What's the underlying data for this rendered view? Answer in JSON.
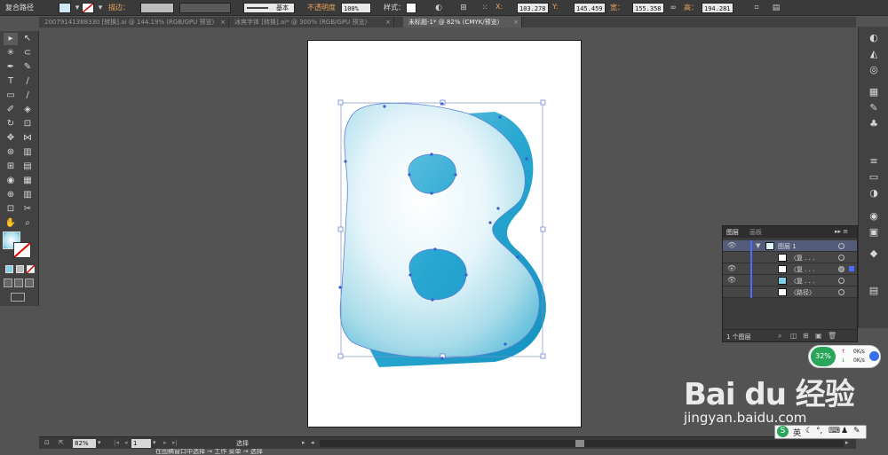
{
  "control_bar": {
    "object_type": "复合路径",
    "stroke_label": "描边：",
    "stroke_style": "基本",
    "opacity_label": "不透明度",
    "opacity_value": "100%",
    "style_label": "样式：",
    "x_label": "X:",
    "x_value": "103.278",
    "y_label": "Y:",
    "y_value": "145.459",
    "w_label": "宽：",
    "w_value": "155.358",
    "h_label": "高：",
    "h_value": "194.281"
  },
  "tabs": [
    {
      "label": "20079141388330 [转换].ai @ 144.19% (RGB/GPU 预览)",
      "active": false
    },
    {
      "label": "冰爽字体 [转换].ai* @ 300% (RGB/GPU 预览)",
      "active": false
    },
    {
      "label": "未标题-1* @ 82% (CMYK/预览)",
      "active": true
    }
  ],
  "tab_close": "×",
  "tools": [
    "▸",
    "↖",
    "✳",
    "⊂",
    "✒",
    "✎",
    "T",
    "/",
    "▭",
    "/",
    "✐",
    "◈",
    "↻",
    "⊡",
    "✥",
    "⋈",
    "⊛",
    "▥",
    "⊞",
    "▤",
    "◉",
    "▦",
    "✋",
    "⌕"
  ],
  "layers_panel": {
    "tab_layers": "图层",
    "tab_artboards": "画板",
    "menu": "▸▸ ≡",
    "rows": [
      {
        "name": "图层 1",
        "eye": "👁",
        "expand": "▼"
      },
      {
        "name": "〈复 . . .",
        "eye": ""
      },
      {
        "name": "〈复 . . .",
        "eye": "👁"
      },
      {
        "name": "〈复 . . .",
        "eye": "👁"
      },
      {
        "name": "〈路径〉",
        "eye": ""
      }
    ],
    "footer_count": "1 个图层"
  },
  "status_bar": {
    "zoom": "82%",
    "artboard_number": "1",
    "tool_name": "选择"
  },
  "net_widget": {
    "percent": "32%",
    "up": "0K/s",
    "down": "0K/s"
  },
  "watermark": {
    "brand": "Bai du 经验",
    "url": "jingyan.baidu.com"
  },
  "ime": {
    "logo": "S",
    "mode": "英"
  },
  "caption": "在图稿窗口中选择 → 工作  菜单 → 选择"
}
